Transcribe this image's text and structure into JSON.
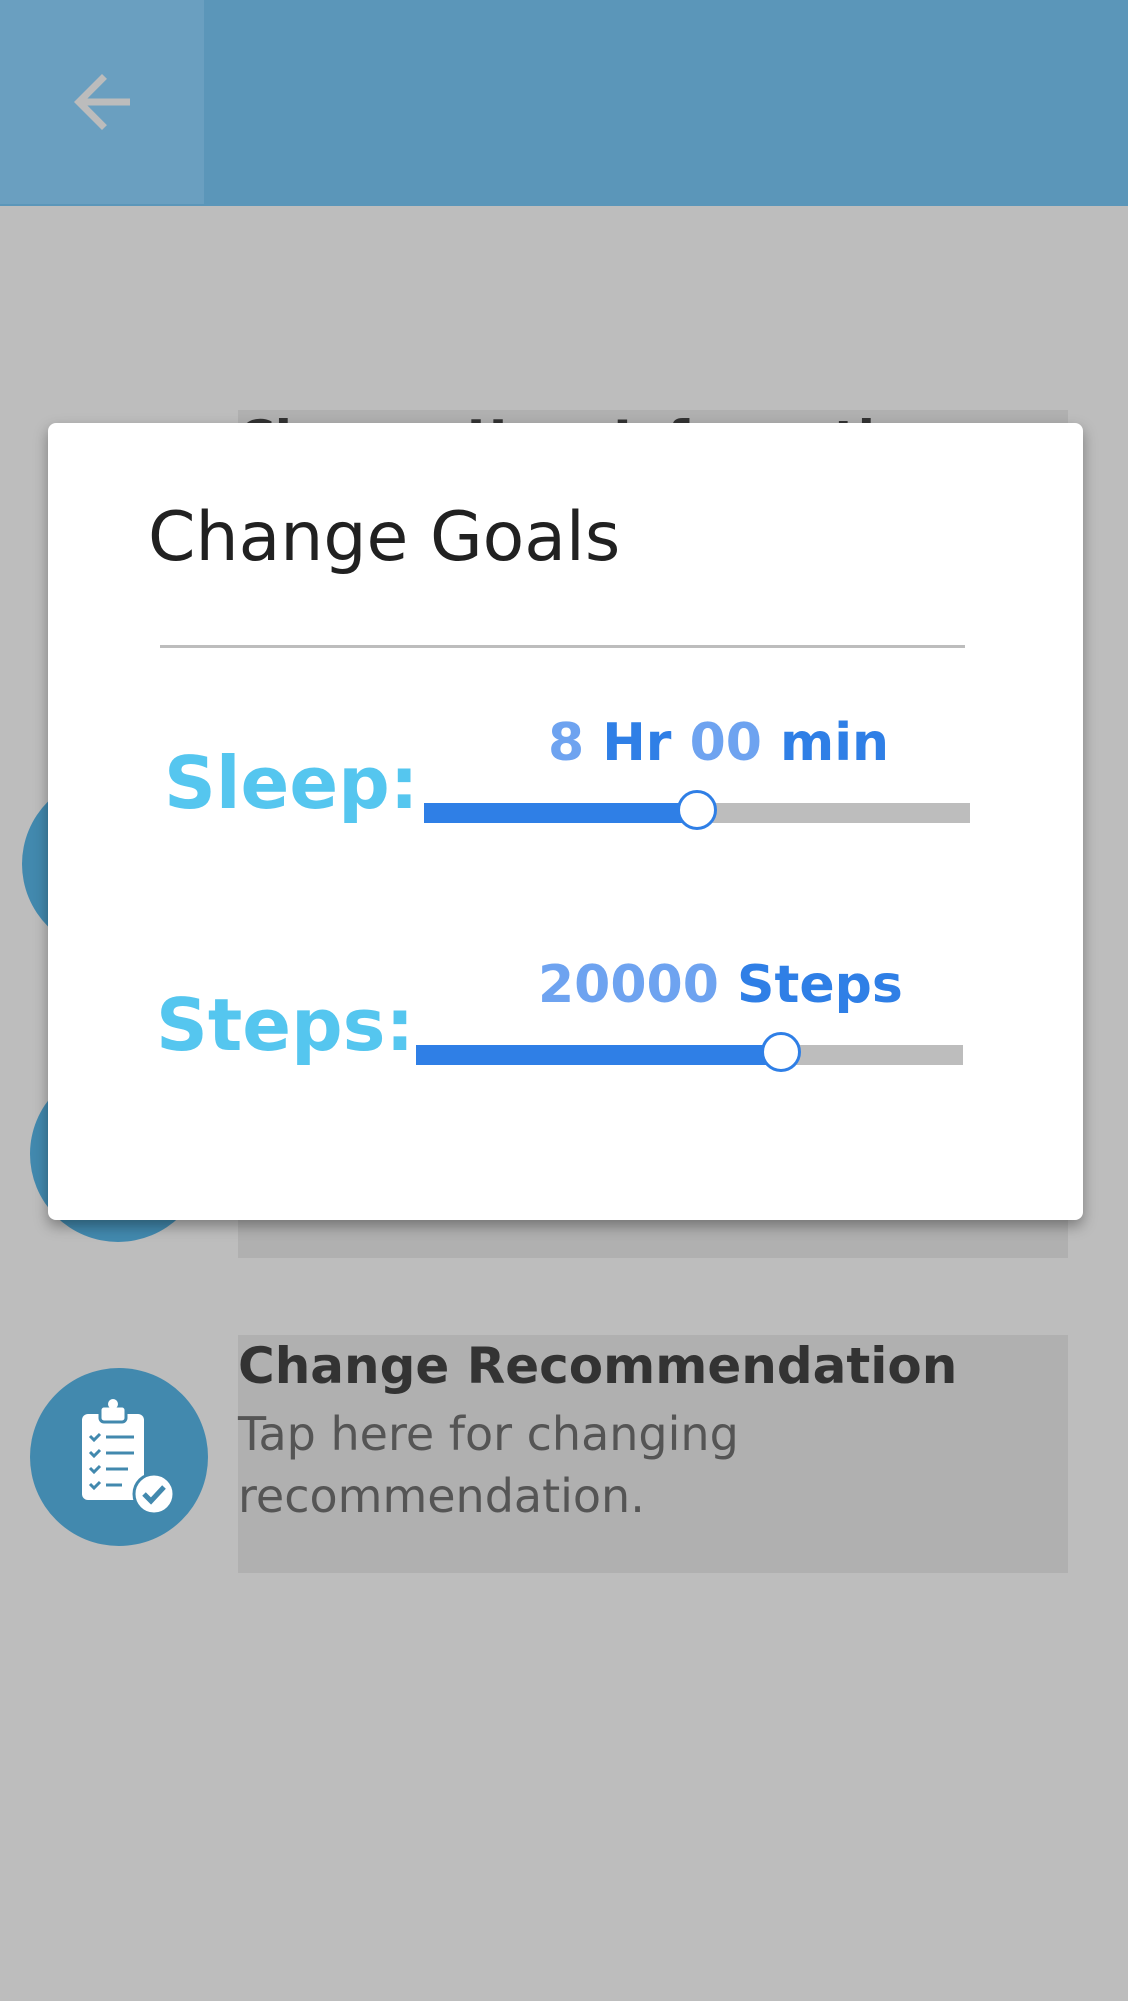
{
  "colors": {
    "appbar": "#5b96b9",
    "accent_blue": "#2f7fe6",
    "label_cyan": "#55c6ef",
    "circle_blue": "#4289ae"
  },
  "background_list": {
    "items": [
      {
        "title": "Change User Information",
        "icon": "user-icon"
      },
      {
        "title": "",
        "icon": "target-icon"
      },
      {
        "title": "",
        "icon": "ring-icon"
      },
      {
        "title": "Change Recommendation",
        "subtitle": "Tap here for changing recommendation.",
        "icon": "clipboard-check-icon"
      }
    ]
  },
  "dialog": {
    "title": "Change Goals",
    "sleep": {
      "label": "Sleep:",
      "value_num": "8",
      "value_unit1": " Hr ",
      "value_num2": "00",
      "value_unit2": " min",
      "fraction": 0.5
    },
    "steps": {
      "label": "Steps:",
      "value_num": "20000",
      "value_unit": " Steps",
      "fraction": 0.667
    }
  }
}
